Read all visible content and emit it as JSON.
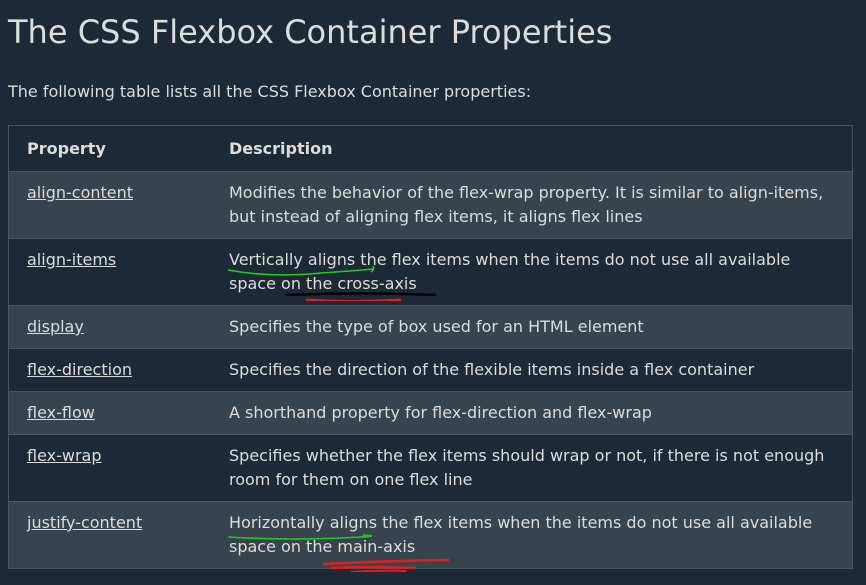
{
  "heading": "The CSS Flexbox Container Properties",
  "intro": "The following table lists all the CSS Flexbox Container properties:",
  "table": {
    "headers": {
      "property": "Property",
      "description": "Description"
    },
    "rows": [
      {
        "property": "align-content",
        "description": "Modifies the behavior of the flex-wrap property. It is similar to align-items, but instead of aligning flex items, it aligns flex lines"
      },
      {
        "property": "align-items",
        "description": "Vertically aligns the flex items when the items do not use all available space on the cross-axis"
      },
      {
        "property": "display",
        "description": "Specifies the type of box used for an HTML element"
      },
      {
        "property": "flex-direction",
        "description": "Specifies the direction of the flexible items inside a flex container"
      },
      {
        "property": "flex-flow",
        "description": "A shorthand property for flex-direction and flex-wrap"
      },
      {
        "property": "flex-wrap",
        "description": "Specifies whether the flex items should wrap or not, if there is not enough room for them on one flex line"
      },
      {
        "property": "justify-content",
        "description": "Horizontally aligns the flex items when the items do not use all available space on the main-axis"
      }
    ]
  },
  "colors": {
    "background": "#1d2a35",
    "row_alt": "#38444d",
    "text": "#dddddd",
    "annotation_green": "#22cc22",
    "annotation_red": "#e02020",
    "annotation_black": "#000000"
  }
}
